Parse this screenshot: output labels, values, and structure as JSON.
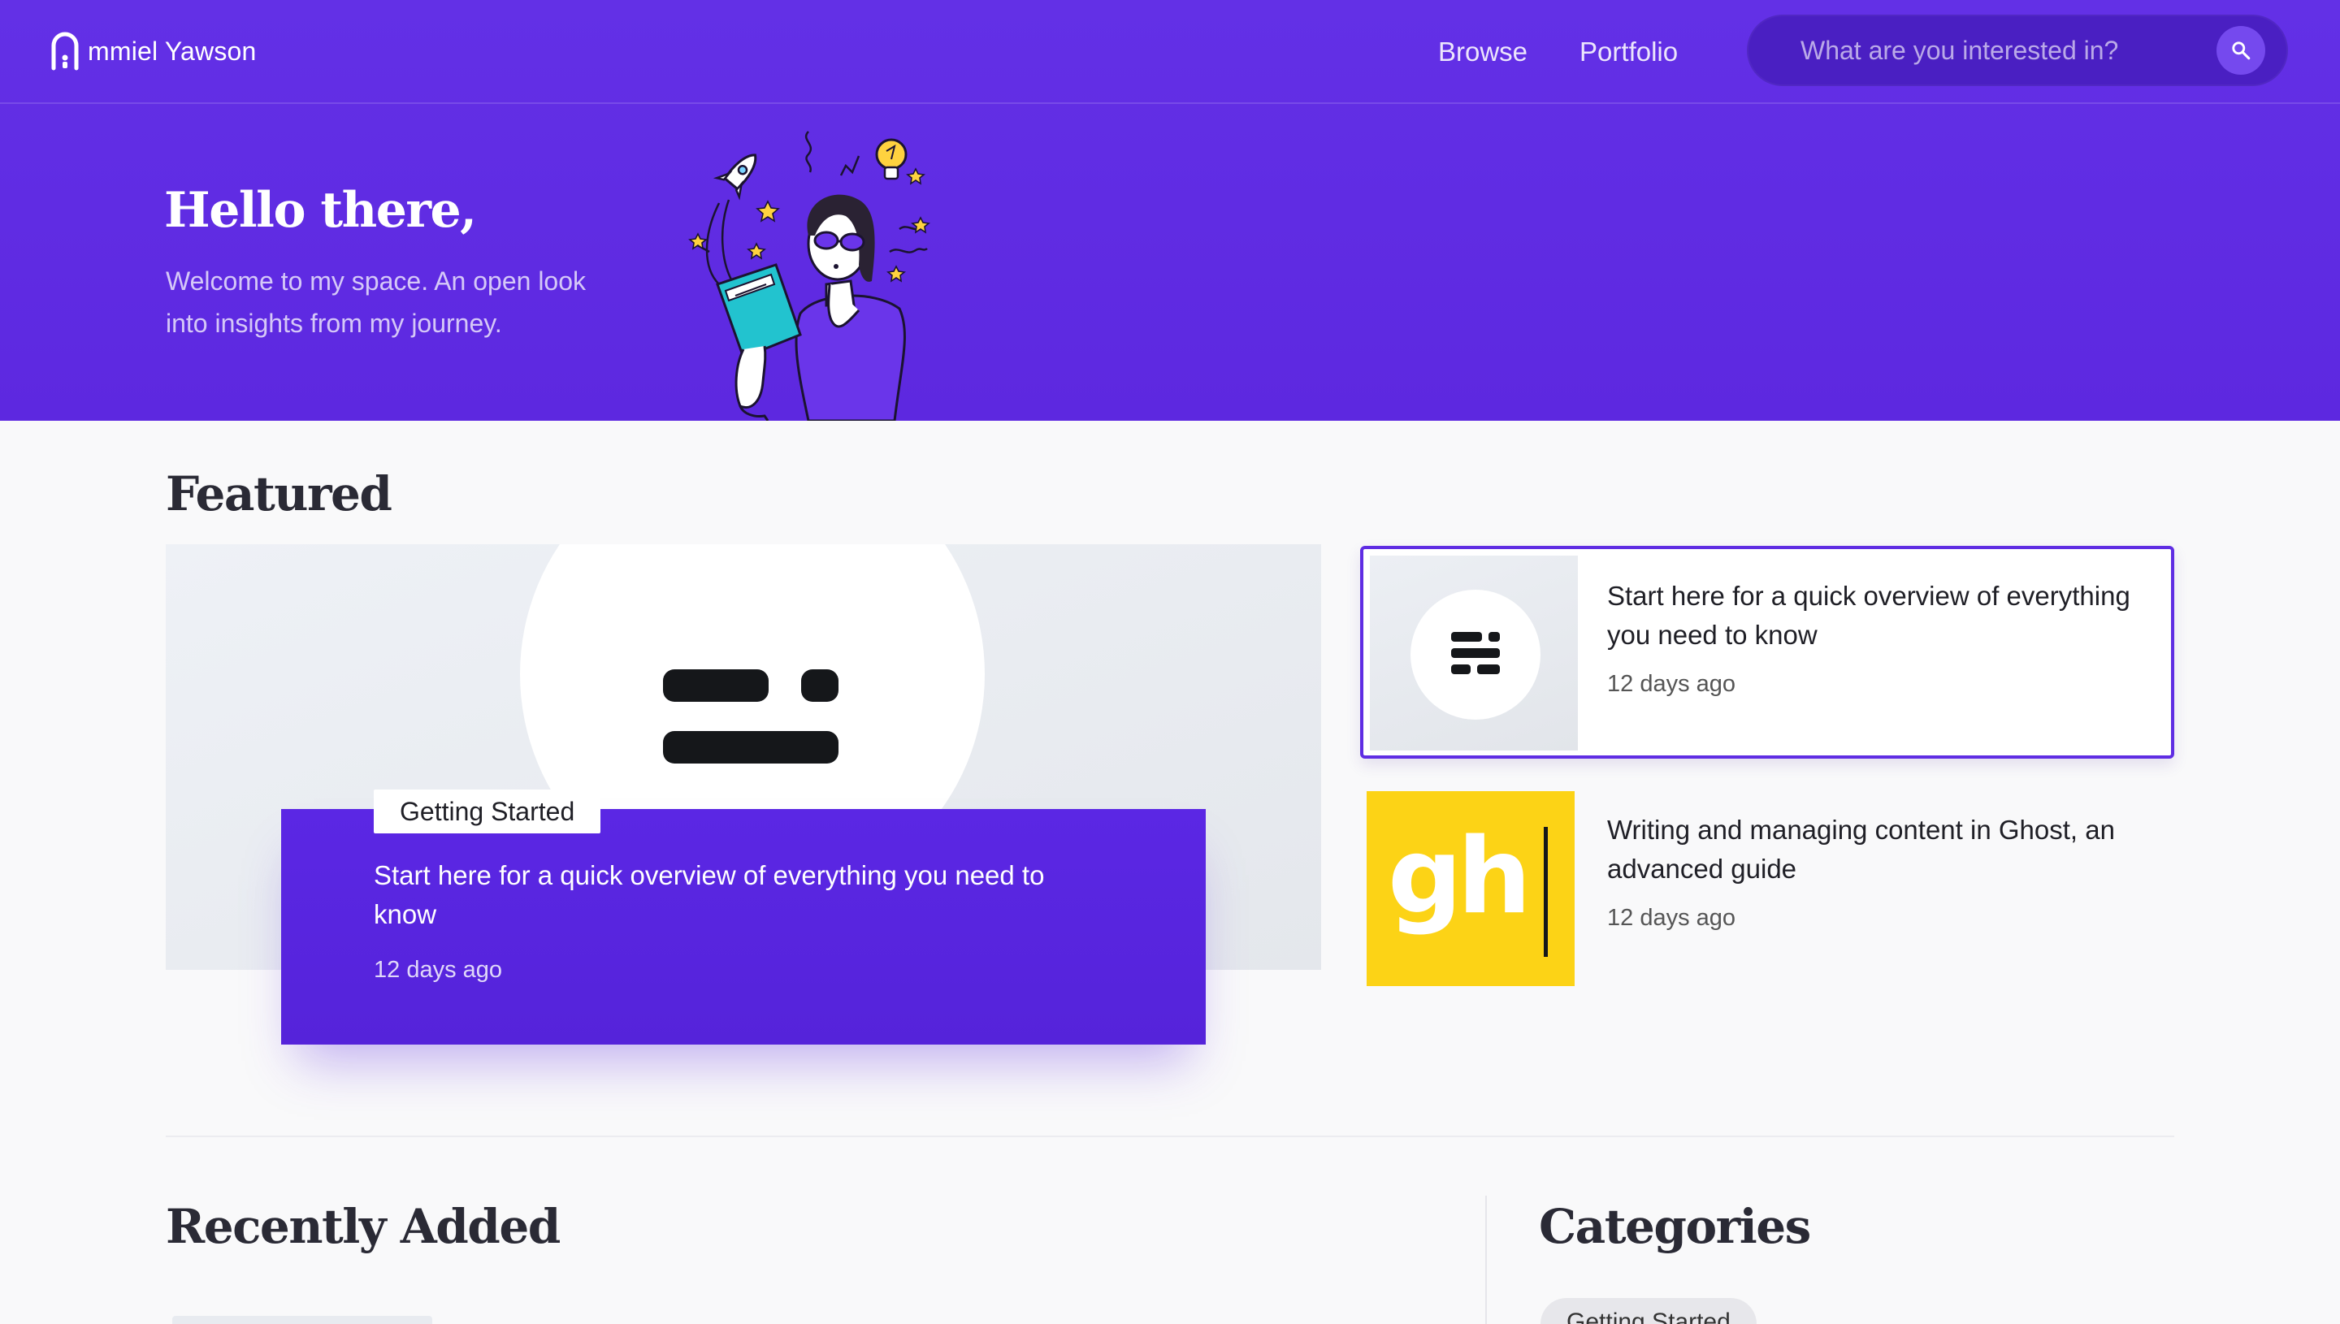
{
  "brand": {
    "name": "mmiel Yawson"
  },
  "nav": {
    "items": [
      {
        "label": "Browse"
      },
      {
        "label": "Portfolio"
      }
    ]
  },
  "search": {
    "placeholder": "What are you interested in?"
  },
  "hero": {
    "title": "Hello there,",
    "subtitle": "Welcome to my space. An open look into insights from my journey."
  },
  "featured": {
    "heading": "Featured",
    "main": {
      "tag": "Getting Started",
      "title": "Start here for a quick overview of everything you need to know",
      "date": "12 days ago"
    },
    "side": [
      {
        "title": "Start here for a quick overview of everything you need to know",
        "date": "12 days ago",
        "thumb": "ghost-logo-icon"
      },
      {
        "title": "Writing and managing content in Ghost, an advanced guide",
        "date": "12 days ago",
        "thumb": "gh-logo-icon",
        "thumb_text": "gh"
      }
    ]
  },
  "recent": {
    "heading": "Recently Added"
  },
  "categories": {
    "heading": "Categories",
    "items": [
      {
        "label": "Getting Started"
      }
    ]
  },
  "colors": {
    "brand_purple": "#5d28e0",
    "search_bg": "#4a1fc2",
    "gh_yellow": "#fcd316"
  }
}
